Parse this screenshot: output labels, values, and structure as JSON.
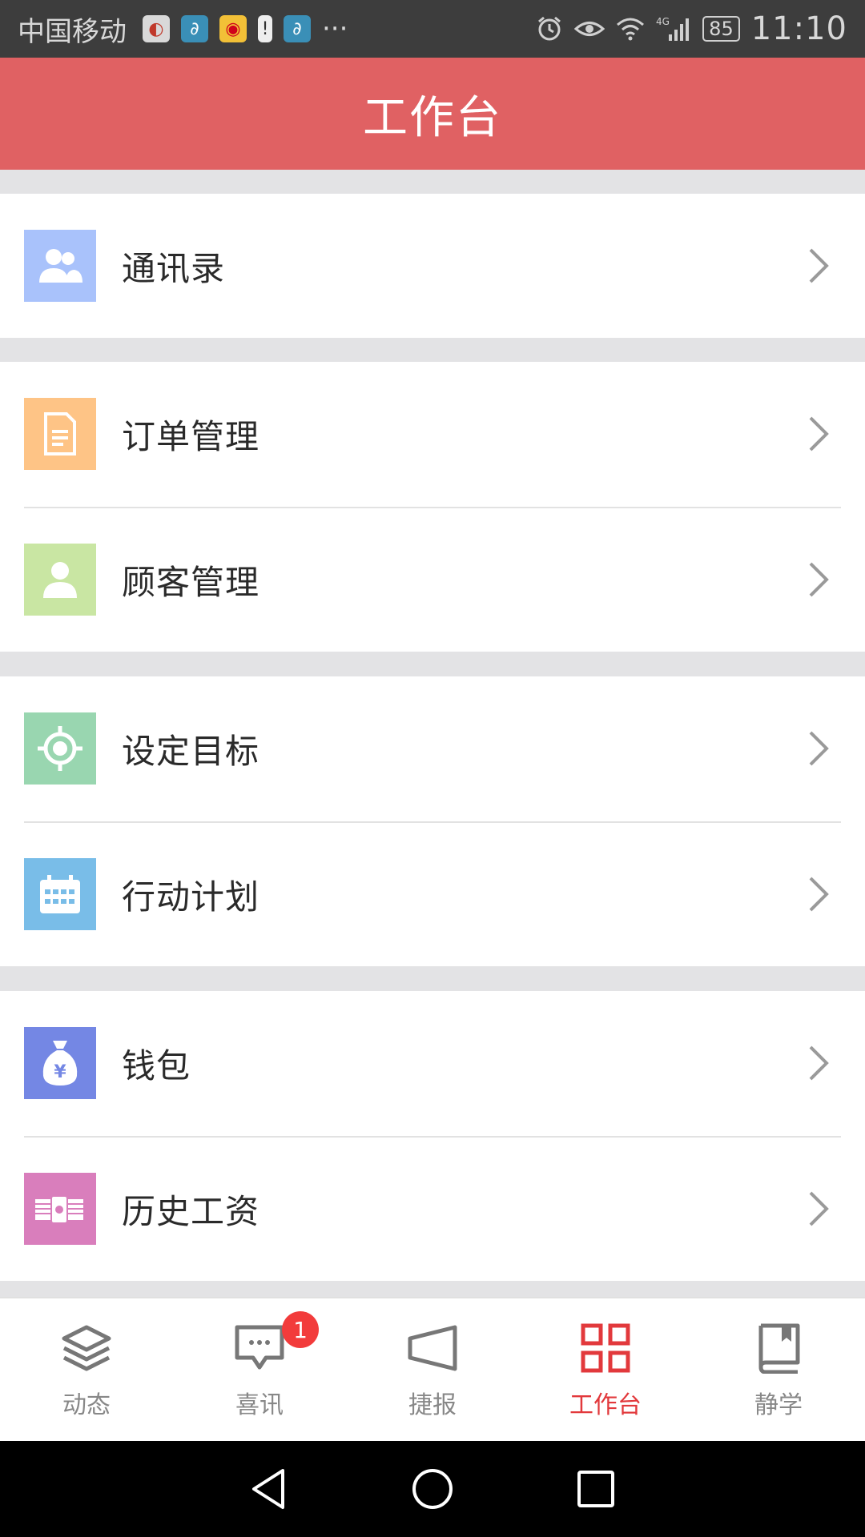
{
  "status_bar": {
    "carrier": "中国移动",
    "app_icons": [
      "app-icon-1",
      "app-icon-2",
      "weibo-icon",
      "battery-alert-icon",
      "app-icon-3"
    ],
    "more": "···",
    "network": "4G",
    "battery": "85",
    "time": "11:10"
  },
  "header": {
    "title": "工作台"
  },
  "groups": [
    {
      "items": [
        {
          "label": "通讯录",
          "icon": "contacts-icon",
          "color": "#a9c2fb"
        }
      ]
    },
    {
      "items": [
        {
          "label": "订单管理",
          "icon": "order-icon",
          "color": "#fec486"
        },
        {
          "label": "顾客管理",
          "icon": "customer-icon",
          "color": "#c9e6a3"
        }
      ]
    },
    {
      "items": [
        {
          "label": "设定目标",
          "icon": "target-icon",
          "color": "#99d6b0"
        },
        {
          "label": "行动计划",
          "icon": "calendar-icon",
          "color": "#79bde8"
        }
      ]
    },
    {
      "items": [
        {
          "label": "钱包",
          "icon": "wallet-icon",
          "color": "#7487e4"
        },
        {
          "label": "历史工资",
          "icon": "salary-icon",
          "color": "#d97ebc"
        }
      ]
    }
  ],
  "bottom_nav": {
    "tabs": [
      {
        "label": "动态",
        "icon": "layers-icon"
      },
      {
        "label": "喜讯",
        "icon": "message-icon",
        "badge": "1"
      },
      {
        "label": "捷报",
        "icon": "megaphone-icon"
      },
      {
        "label": "工作台",
        "icon": "grid-icon",
        "active": true
      },
      {
        "label": "静学",
        "icon": "book-icon"
      }
    ],
    "active_color": "#e2393c",
    "inactive_color": "#888888"
  },
  "system_nav": {
    "buttons": [
      "back-icon",
      "home-icon",
      "recents-icon"
    ]
  }
}
